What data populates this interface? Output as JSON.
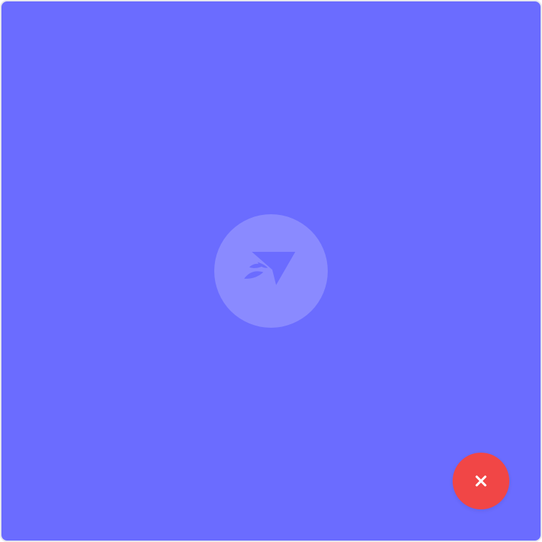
{
  "app": {
    "title": ""
  },
  "main": {
    "logo_icon": "send-paper-plane-icon",
    "panel_color": "#6b6cff",
    "badge_color": "#8a8aff"
  },
  "actions": {
    "close_icon": "close-icon",
    "close_color": "#f14646"
  }
}
